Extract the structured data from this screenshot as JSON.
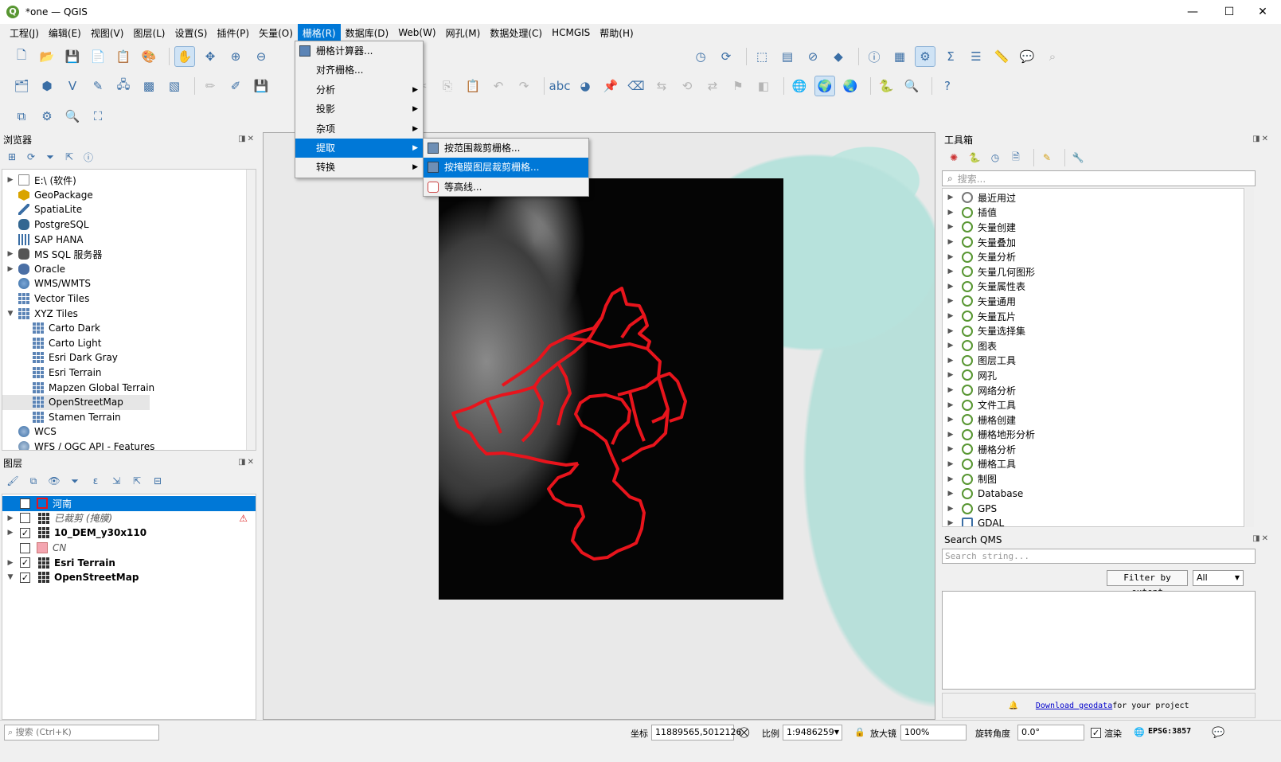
{
  "window": {
    "title": "*one — QGIS",
    "minimize": "—",
    "maximize": "☐",
    "close": "✕"
  },
  "menubar": [
    {
      "label": "工程(J)"
    },
    {
      "label": "编辑(E)"
    },
    {
      "label": "视图(V)"
    },
    {
      "label": "图层(L)"
    },
    {
      "label": "设置(S)"
    },
    {
      "label": "插件(P)"
    },
    {
      "label": "矢量(O)"
    },
    {
      "label": "栅格(R)",
      "active": true
    },
    {
      "label": "数据库(D)"
    },
    {
      "label": "Web(W)"
    },
    {
      "label": "网孔(M)"
    },
    {
      "label": "数据处理(C)"
    },
    {
      "label": "HCMGIS"
    },
    {
      "label": "帮助(H)"
    }
  ],
  "raster_menu": {
    "items": [
      {
        "label": "栅格计算器...",
        "submenu": false
      },
      {
        "label": "对齐栅格...",
        "submenu": false
      },
      {
        "label": "分析",
        "submenu": true
      },
      {
        "label": "投影",
        "submenu": true
      },
      {
        "label": "杂项",
        "submenu": true
      },
      {
        "label": "提取",
        "submenu": true,
        "highlighted": true
      },
      {
        "label": "转换",
        "submenu": true
      }
    ],
    "submenu_arrow": "▶",
    "extract_submenu": [
      {
        "label": "按范围裁剪栅格..."
      },
      {
        "label": "按掩膜图层裁剪栅格...",
        "highlighted": true
      },
      {
        "label": "等高线..."
      }
    ]
  },
  "browser": {
    "title": "浏览器",
    "items": [
      {
        "label": "E:\\ (软件)",
        "indent": 0,
        "expand": "▶",
        "icon": "folder-icon"
      },
      {
        "label": "GeoPackage",
        "indent": 0,
        "expand": "",
        "icon": "geopackage-icon"
      },
      {
        "label": "SpatiaLite",
        "indent": 0,
        "expand": "",
        "icon": "spatialite-icon"
      },
      {
        "label": "PostgreSQL",
        "indent": 0,
        "expand": "",
        "icon": "postgresql-icon"
      },
      {
        "label": "SAP HANA",
        "indent": 0,
        "expand": "",
        "icon": "hana-icon"
      },
      {
        "label": "MS SQL 服务器",
        "indent": 0,
        "expand": "▶",
        "icon": "mssql-icon"
      },
      {
        "label": "Oracle",
        "indent": 0,
        "expand": "▶",
        "icon": "oracle-icon"
      },
      {
        "label": "WMS/WMTS",
        "indent": 0,
        "expand": "",
        "icon": "wms-icon"
      },
      {
        "label": "Vector Tiles",
        "indent": 0,
        "expand": "",
        "icon": "vector-tiles-icon"
      },
      {
        "label": "XYZ Tiles",
        "indent": 0,
        "expand": "▼",
        "icon": "xyz-icon"
      },
      {
        "label": "Carto Dark",
        "indent": 1,
        "expand": "",
        "icon": "tile-icon"
      },
      {
        "label": "Carto Light",
        "indent": 1,
        "expand": "",
        "icon": "tile-icon"
      },
      {
        "label": "Esri Dark Gray",
        "indent": 1,
        "expand": "",
        "icon": "tile-icon"
      },
      {
        "label": "Esri Terrain",
        "indent": 1,
        "expand": "",
        "icon": "tile-icon"
      },
      {
        "label": "Mapzen Global Terrain",
        "indent": 1,
        "expand": "",
        "icon": "tile-icon"
      },
      {
        "label": "OpenStreetMap",
        "indent": 1,
        "expand": "",
        "icon": "tile-icon",
        "selected": true
      },
      {
        "label": "Stamen Terrain",
        "indent": 1,
        "expand": "",
        "icon": "tile-icon"
      },
      {
        "label": "WCS",
        "indent": 0,
        "expand": "",
        "icon": "wcs-icon"
      },
      {
        "label": "WFS / OGC API - Features",
        "indent": 0,
        "expand": "",
        "icon": "wfs-icon"
      }
    ]
  },
  "layers": {
    "title": "图层",
    "items": [
      {
        "label": "河南",
        "checked": true,
        "expand": "",
        "type": "polygon-red",
        "selected": true,
        "bold": false
      },
      {
        "label": "已裁剪 (掩膜)",
        "checked": false,
        "expand": "▶",
        "type": "raster",
        "italic": true,
        "warning": true
      },
      {
        "label": "10_DEM_y30x110",
        "checked": true,
        "expand": "▶",
        "type": "raster",
        "bold": true
      },
      {
        "label": "CN",
        "checked": false,
        "expand": "",
        "type": "polygon-pink",
        "italic": true
      },
      {
        "label": "Esri Terrain",
        "checked": true,
        "expand": "▶",
        "type": "raster",
        "bold": true
      },
      {
        "label": "OpenStreetMap",
        "checked": true,
        "expand": "▼",
        "type": "raster",
        "bold": true
      }
    ],
    "checkmark": "✓",
    "warning_glyph": "⚠"
  },
  "toolbox": {
    "title": "工具箱",
    "search_placeholder": "搜索...",
    "items": [
      {
        "label": "最近用过",
        "icon": "clock-icon"
      },
      {
        "label": "插值"
      },
      {
        "label": "矢量创建"
      },
      {
        "label": "矢量叠加"
      },
      {
        "label": "矢量分析"
      },
      {
        "label": "矢量几何图形"
      },
      {
        "label": "矢量属性表"
      },
      {
        "label": "矢量通用"
      },
      {
        "label": "矢量瓦片"
      },
      {
        "label": "矢量选择集"
      },
      {
        "label": "图表"
      },
      {
        "label": "图层工具"
      },
      {
        "label": "网孔"
      },
      {
        "label": "网络分析"
      },
      {
        "label": "文件工具"
      },
      {
        "label": "栅格创建"
      },
      {
        "label": "栅格地形分析"
      },
      {
        "label": "栅格分析"
      },
      {
        "label": "栅格工具"
      },
      {
        "label": "制图"
      },
      {
        "label": "Database"
      },
      {
        "label": "GPS"
      },
      {
        "label": "GDAL",
        "icon": "gdal-icon"
      }
    ]
  },
  "qms": {
    "title": "Search QMS",
    "search_placeholder": "Search string...",
    "filter_button": "Filter by extent",
    "filter_select": "All",
    "download_link": "Download geodata",
    "download_suffix": " for your project"
  },
  "statusbar": {
    "search_placeholder": "搜索 (Ctrl+K)",
    "coord_label": "坐标",
    "coord_value": "11889565,5012126",
    "scale_label": "比例",
    "scale_value": "1:9486259",
    "magnifier_label": "放大镜",
    "magnifier_value": "100%",
    "rotation_label": "旋转角度",
    "rotation_value": "0.0°",
    "render_label": "渲染",
    "crs": "EPSG:3857"
  },
  "colors": {
    "accent": "#0078d7",
    "boundary": "#e8141c",
    "qgis_green": "#589632"
  }
}
